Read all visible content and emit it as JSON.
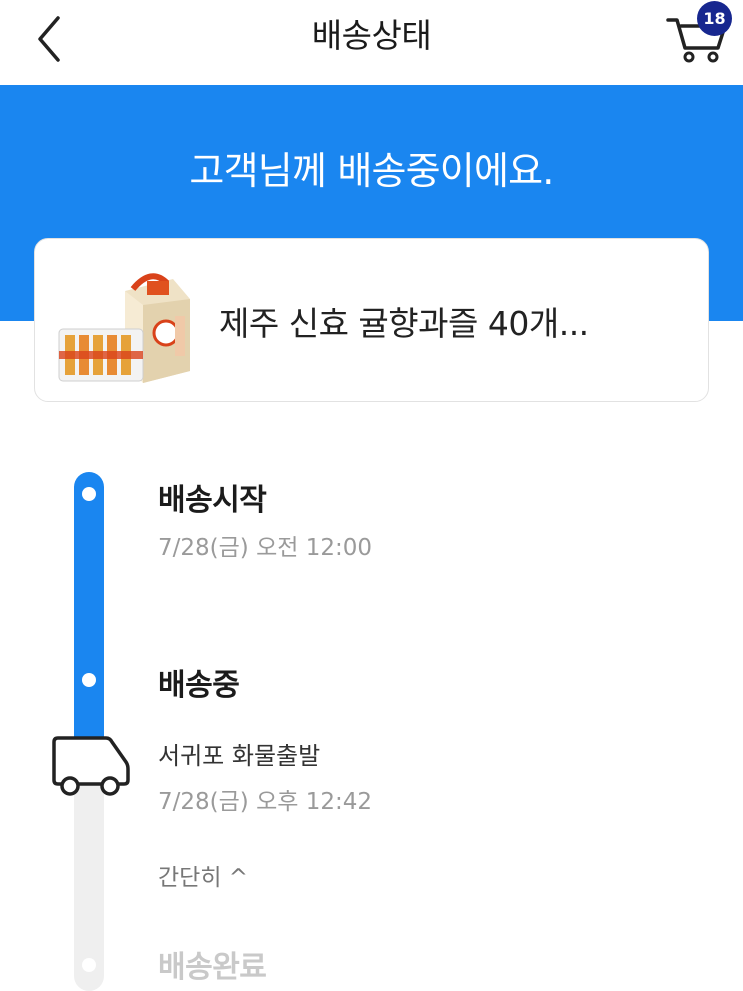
{
  "header": {
    "title": "배송상태",
    "back_icon": "chevron-left-icon",
    "cart_icon": "cart-icon",
    "cart_count": "18"
  },
  "hero": {
    "message": "고객님께 배송중이에요."
  },
  "product": {
    "name": "제주 신효 귤향과즐 40개..."
  },
  "timeline": {
    "start": {
      "title": "배송시작",
      "time": "7/28(금) 오전 12:00"
    },
    "in_transit": {
      "title": "배송중",
      "location": "서귀포 화물출발",
      "time": "7/28(금) 오후 12:42",
      "collapse_label": "간단히 ^"
    },
    "complete": {
      "title": "배송완료"
    }
  },
  "colors": {
    "accent": "#1a86f0",
    "badge": "#17278f",
    "track_inactive": "#efefef"
  }
}
